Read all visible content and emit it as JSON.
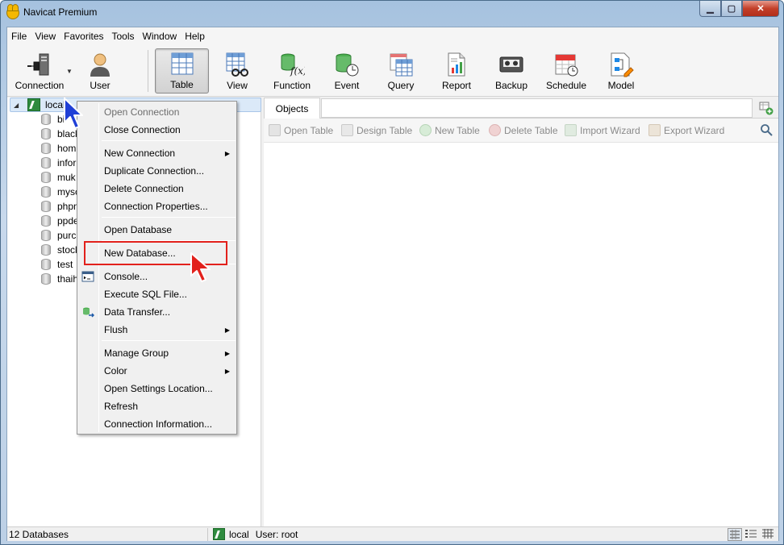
{
  "window": {
    "title": "Navicat Premium"
  },
  "menubar": {
    "items": [
      "File",
      "View",
      "Favorites",
      "Tools",
      "Window",
      "Help"
    ]
  },
  "toolbar": {
    "buttons": [
      {
        "label": "Connection",
        "icon": "connection-icon"
      },
      {
        "label": "User",
        "icon": "user-icon"
      },
      {
        "label": "Table",
        "icon": "table-icon",
        "active": true
      },
      {
        "label": "View",
        "icon": "view-icon"
      },
      {
        "label": "Function",
        "icon": "function-icon"
      },
      {
        "label": "Event",
        "icon": "event-icon"
      },
      {
        "label": "Query",
        "icon": "query-icon"
      },
      {
        "label": "Report",
        "icon": "report-icon"
      },
      {
        "label": "Backup",
        "icon": "backup-icon"
      },
      {
        "label": "Schedule",
        "icon": "schedule-icon"
      },
      {
        "label": "Model",
        "icon": "model-icon"
      }
    ]
  },
  "tree": {
    "root": {
      "label": "local"
    },
    "databases": [
      "bi",
      "black",
      "hom",
      "infor",
      "muk",
      "mysc",
      "phpn",
      "ppde",
      "purch",
      "stock",
      "test",
      "thaih"
    ]
  },
  "objects": {
    "tab_label": "Objects",
    "actions": [
      "Open Table",
      "Design Table",
      "New Table",
      "Delete Table",
      "Import Wizard",
      "Export Wizard"
    ]
  },
  "context_menu": {
    "items": [
      {
        "label": "Open Connection",
        "disabled": true
      },
      {
        "label": "Close Connection"
      },
      {
        "label": "New Connection",
        "submenu": true
      },
      {
        "label": "Duplicate Connection..."
      },
      {
        "label": "Delete Connection"
      },
      {
        "label": "Connection Properties..."
      },
      {
        "label": "Open Database"
      },
      {
        "label": "New Database...",
        "highlighted": true
      },
      {
        "label": "Console..."
      },
      {
        "label": "Execute SQL File..."
      },
      {
        "label": "Data Transfer..."
      },
      {
        "label": "Flush",
        "submenu": true
      },
      {
        "label": "Manage Group",
        "submenu": true
      },
      {
        "label": "Color",
        "submenu": true
      },
      {
        "label": "Open Settings Location..."
      },
      {
        "label": "Refresh"
      },
      {
        "label": "Connection Information..."
      }
    ]
  },
  "statusbar": {
    "db_count": "12 Databases",
    "connection": "local",
    "user": "User: root"
  },
  "colors": {
    "highlight": "#e2211c",
    "accent": "#2e8b3e"
  }
}
